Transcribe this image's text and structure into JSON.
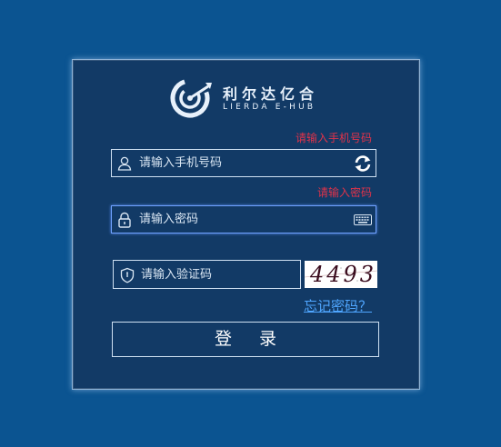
{
  "brand": {
    "name_cn": "利尔达亿合",
    "name_en": "LIERDA E-HUB",
    "logo_icon": "target-c-logo-icon"
  },
  "phone": {
    "error": "请输入手机号码",
    "placeholder": "请输入手机号码",
    "value": "",
    "icon": "user-icon",
    "action_icon": "refresh-icon"
  },
  "password": {
    "error": "请输入密码",
    "placeholder": "请输入密码",
    "value": "",
    "icon": "lock-icon",
    "action_icon": "keyboard-icon"
  },
  "captcha": {
    "placeholder": "请输入验证码",
    "value": "",
    "icon": "shield-icon",
    "image_text": "4493"
  },
  "forgot_password": "忘记密码？",
  "login_button": "登 录",
  "colors": {
    "background": "#0b5491",
    "panel": "#123a66",
    "error": "#e1334a",
    "link": "#4fa6ff"
  }
}
